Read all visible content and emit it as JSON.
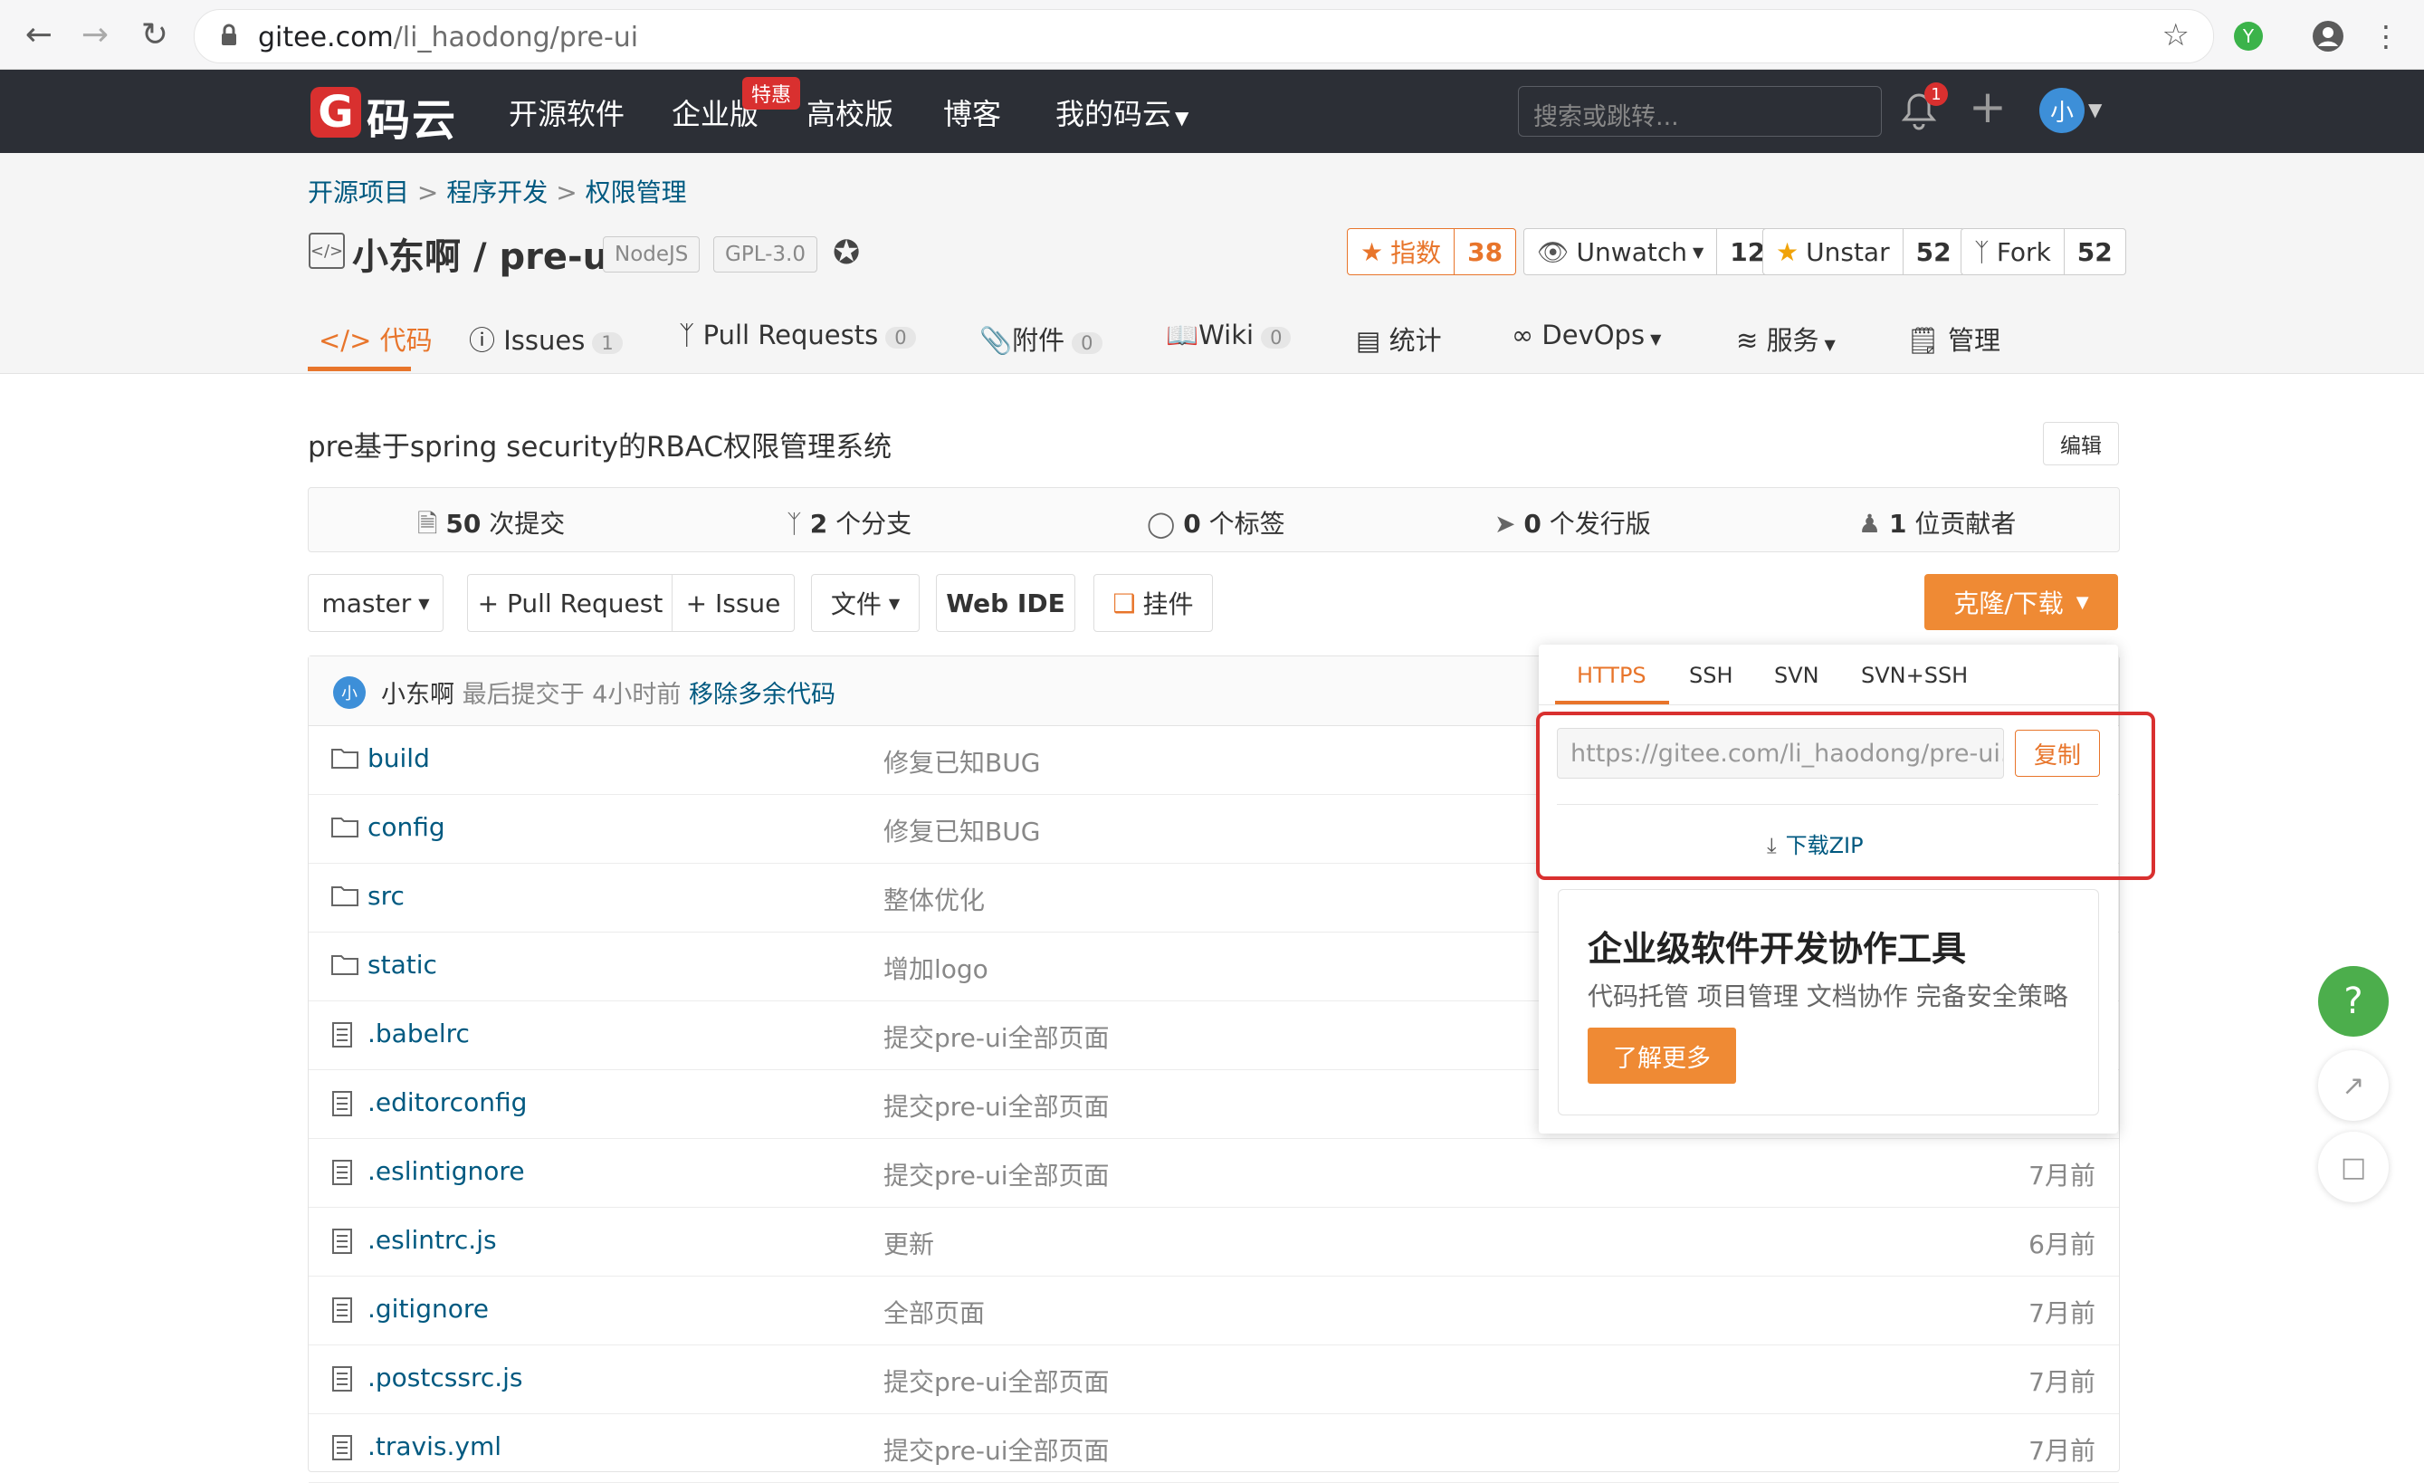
{
  "browser": {
    "url": "gitee.com/li_haodong/pre-ui",
    "url_host": "gitee.com",
    "url_path": "/li_haodong/pre-ui",
    "ext_badge": "Y"
  },
  "header": {
    "logo_mark": "G",
    "logo_text": "码云",
    "nav": [
      "开源软件",
      "企业版",
      "高校版",
      "博客",
      "我的码云"
    ],
    "badge_tehui": "特惠",
    "search_placeholder": "搜索或跳转...",
    "notif_count": "1",
    "avatar": "小"
  },
  "breadcrumb": [
    "开源项目",
    "程序开发",
    "权限管理"
  ],
  "repo": {
    "owner": "小东啊",
    "sep": "/",
    "name": "pre-ui",
    "tags": [
      "NodeJS",
      "GPL-3.0"
    ],
    "index_label": "指数",
    "index_value": "38",
    "watch_label": "Unwatch",
    "watch_count": "12",
    "star_label": "Unstar",
    "star_count": "52",
    "fork_label": "Fork",
    "fork_count": "52"
  },
  "tabs": [
    {
      "label": "代码",
      "count": ""
    },
    {
      "label": "Issues",
      "count": "1"
    },
    {
      "label": "Pull Requests",
      "count": "0"
    },
    {
      "label": "附件",
      "count": "0"
    },
    {
      "label": "Wiki",
      "count": "0"
    },
    {
      "label": "统计",
      "count": ""
    },
    {
      "label": "DevOps",
      "count": ""
    },
    {
      "label": "服务",
      "count": ""
    },
    {
      "label": "管理",
      "count": ""
    }
  ],
  "description": "pre基于spring security的RBAC权限管理系统",
  "edit_label": "编辑",
  "stats": [
    {
      "num": "50",
      "label": "次提交"
    },
    {
      "num": "2",
      "label": "个分支"
    },
    {
      "num": "0",
      "label": "个标签"
    },
    {
      "num": "0",
      "label": "个发行版"
    },
    {
      "num": "1",
      "label": "位贡献者"
    }
  ],
  "actions": {
    "branch": "master",
    "pull_request": "+ Pull Request",
    "issue": "+ Issue",
    "file": "文件",
    "web_ide": "Web IDE",
    "widget": "挂件",
    "clone": "克隆/下载"
  },
  "commit": {
    "avatar": "小",
    "user": "小东啊",
    "meta": "最后提交于 4小时前",
    "message": "移除多余代码"
  },
  "files": [
    {
      "name": "build",
      "kind": "folder",
      "msg": "修复已知BUG",
      "time": ""
    },
    {
      "name": "config",
      "kind": "folder",
      "msg": "修复已知BUG",
      "time": ""
    },
    {
      "name": "src",
      "kind": "folder",
      "msg": "整体优化",
      "time": ""
    },
    {
      "name": "static",
      "kind": "folder",
      "msg": "增加logo",
      "time": ""
    },
    {
      "name": ".babelrc",
      "kind": "file",
      "msg": "提交pre-ui全部页面",
      "time": ""
    },
    {
      "name": ".editorconfig",
      "kind": "file",
      "msg": "提交pre-ui全部页面",
      "time": ""
    },
    {
      "name": ".eslintignore",
      "kind": "file",
      "msg": "提交pre-ui全部页面",
      "time": "7月前"
    },
    {
      "name": ".eslintrc.js",
      "kind": "file",
      "msg": "更新",
      "time": "6月前"
    },
    {
      "name": ".gitignore",
      "kind": "file",
      "msg": "全部页面",
      "time": "7月前"
    },
    {
      "name": ".postcssrc.js",
      "kind": "file",
      "msg": "提交pre-ui全部页面",
      "time": "7月前"
    },
    {
      "name": ".travis.yml",
      "kind": "file",
      "msg": "提交pre-ui全部页面",
      "time": "7月前"
    }
  ],
  "clone_panel": {
    "protocols": [
      "HTTPS",
      "SSH",
      "SVN",
      "SVN+SSH"
    ],
    "url": "https://gitee.com/li_haodong/pre-ui.git",
    "copy": "复制",
    "download_zip": "下载ZIP",
    "promo_title": "企业级软件开发协作工具",
    "promo_sub": "代码托管 项目管理 文档协作 完备安全策略",
    "promo_btn": "了解更多"
  },
  "float_help": "?",
  "colors": {
    "accent_orange": "#e8752b",
    "header_dark": "#2c2f36",
    "link_blue": "#005980",
    "brand_red": "#d9302f",
    "help_green": "#4cae4c"
  }
}
